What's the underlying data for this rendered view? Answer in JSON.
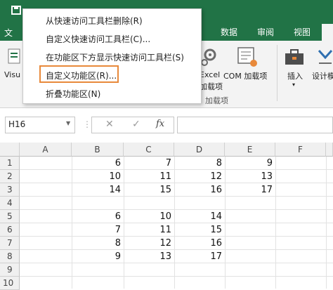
{
  "titlebar": {
    "file_tab": "文"
  },
  "tabs": [
    {
      "label": "数据"
    },
    {
      "label": "审阅"
    },
    {
      "label": "视图"
    }
  ],
  "ribbon": {
    "visual_basic_partial": "Visu",
    "excel_addins_top": "Excel",
    "excel_addins_bottom": "加载项",
    "com_addins": "COM 加载项",
    "insert_label": "插入",
    "design_partial": "设计模",
    "addins_group": "加载项"
  },
  "menu": {
    "items": [
      {
        "label": "从快速访问工具栏删除(R)"
      },
      {
        "label": "自定义快速访问工具栏(C)..."
      },
      {
        "label": "在功能区下方显示快速访问工具栏(S)"
      },
      {
        "label": "自定义功能区(R)..."
      },
      {
        "label": "折叠功能区(N)"
      }
    ]
  },
  "formula_bar": {
    "name_box": "H16",
    "cancel_symbol": "✕",
    "enter_symbol": "✓",
    "fx_symbol": "fx",
    "formula": ""
  },
  "sheet": {
    "columns": [
      "A",
      "B",
      "C",
      "D",
      "E",
      "F"
    ],
    "rows": [
      "1",
      "2",
      "3",
      "4",
      "5",
      "6",
      "7",
      "8",
      "9",
      "10"
    ],
    "cells": {
      "B1": "6",
      "C1": "7",
      "D1": "8",
      "E1": "9",
      "B2": "10",
      "C2": "11",
      "D2": "12",
      "E2": "13",
      "B3": "14",
      "C3": "15",
      "D3": "16",
      "E3": "17",
      "B5": "6",
      "C5": "10",
      "D5": "14",
      "B6": "7",
      "C6": "11",
      "D6": "15",
      "B7": "8",
      "C7": "12",
      "D7": "16",
      "B8": "9",
      "C8": "13",
      "D8": "17"
    }
  },
  "colors": {
    "accent": "#217346",
    "highlight": "#e8893a"
  }
}
